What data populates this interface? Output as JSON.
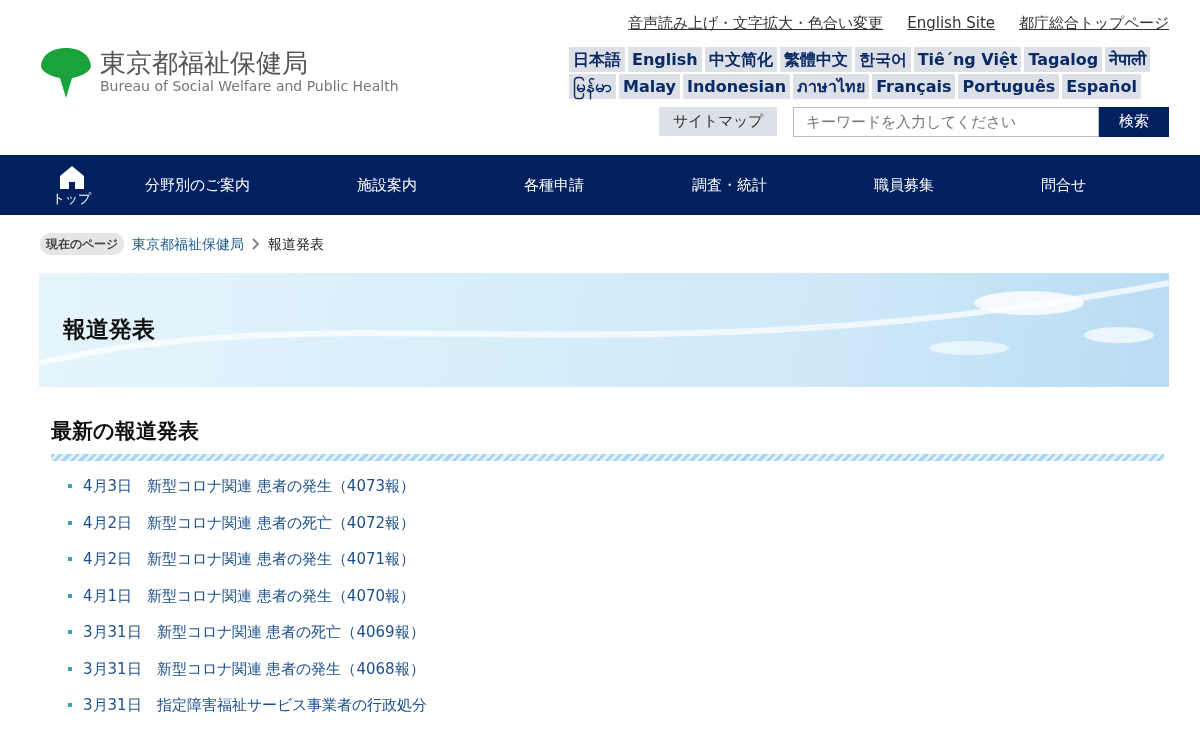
{
  "header": {
    "logo_title": "東京都福祉保健局",
    "logo_subtitle": "Bureau of Social Welfare and Public Health",
    "utility_links": [
      "音声読み上げ・文字拡大・色合い変更",
      "English Site",
      "都庁総合トップページ"
    ],
    "language_rows": [
      [
        "日本語",
        "English",
        "中文简化",
        "繁體中文",
        "한국어",
        "Tiê´ng Việt",
        "Tagalog",
        "नेपाली"
      ],
      [
        "မြန်မာ",
        "Malay",
        "Indonesian",
        "ภาษาไทย",
        "Français",
        "Português",
        "Español"
      ]
    ],
    "sitemap": "サイトマップ",
    "search": {
      "placeholder": "キーワードを入力してください",
      "button": "検索"
    }
  },
  "nav": {
    "home": "トップ",
    "items": [
      "分野別のご案内",
      "施設案内",
      "各種申請",
      "調査・統計",
      "職員募集",
      "問合せ"
    ]
  },
  "breadcrumb": {
    "label": "現在のページ",
    "links": [
      "東京都福祉保健局"
    ],
    "current": "報道発表"
  },
  "page_title": "報道発表",
  "section": {
    "heading": "最新の報道発表",
    "items": [
      "4月3日　新型コロナ関連 患者の発生（4073報）",
      "4月2日　新型コロナ関連 患者の死亡（4072報）",
      "4月2日　新型コロナ関連 患者の発生（4071報）",
      "4月1日　新型コロナ関連 患者の発生（4070報）",
      "3月31日　新型コロナ関連 患者の死亡（4069報）",
      "3月31日　新型コロナ関連 患者の発生（4068報）",
      "3月31日　指定障害福祉サービス事業者の行政処分"
    ]
  }
}
